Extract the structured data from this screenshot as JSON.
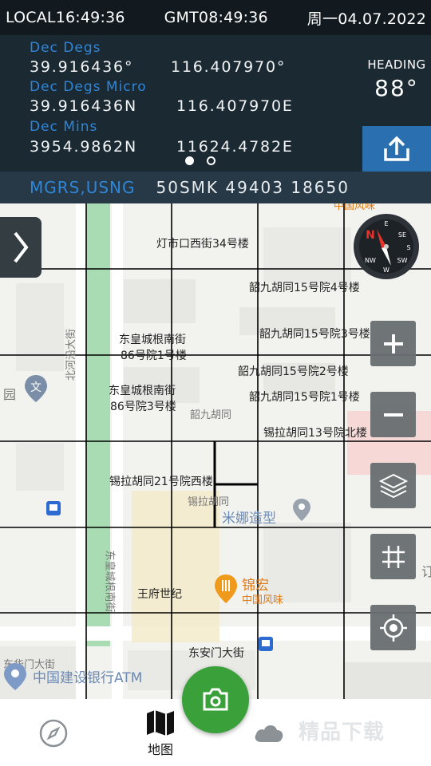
{
  "statusbar": {
    "local_time": "LOCAL16:49:36",
    "gmt_time": "GMT08:49:36",
    "date": "周一04.07.2022"
  },
  "coords": {
    "dec_degs_label": "Dec  Degs",
    "dec_degs_lat": "39.916436°",
    "dec_degs_lon": "116.407970°",
    "dec_micro_label": "Dec  Degs  Micro",
    "dec_micro_lat": "39.916436N",
    "dec_micro_lon": "116.407970E",
    "dec_mins_label": "Dec  Mins",
    "dec_mins_lat": "3954.9862N",
    "dec_mins_lon": "11624.4782E",
    "page_index": 1,
    "page_count": 2
  },
  "heading": {
    "label": "HEADING",
    "value": "88°"
  },
  "mgrs": {
    "label": "MGRS,USNG",
    "value": "50SMK  49403  18650"
  },
  "map": {
    "labels": {
      "a": "灯市口西街34号楼",
      "b": "韶九胡同15号院4号楼",
      "c": "韶九胡同15号院3号楼",
      "d1": "东皇城根南街",
      "d2": "86号院1号楼",
      "e": "韶九胡同15号院2号楼",
      "f1": "东皇城根南街",
      "f2": "86号院3号楼",
      "g": "韶九胡同15号院1号楼",
      "h": "韶九胡同",
      "i": "锡拉胡同13号院北楼",
      "j": "锡拉胡同21号院西楼",
      "k": "锡拉胡同",
      "l": "米娜造型",
      "m": "北河沿大街",
      "n": "东皇城根南街",
      "o": "王府世纪",
      "p": "锦宏",
      "q": "中国风味",
      "r": "东安门大街",
      "s": "东华门大街",
      "t": "中国建设银行ATM",
      "u": "中国风味",
      "v": "园",
      "w": "订"
    }
  },
  "icons": {
    "plus": "zoom-in-icon",
    "minus": "zoom-out-icon",
    "layers": "layers-icon",
    "grid": "grid-icon",
    "locate": "locate-icon",
    "share": "share-icon",
    "compass": "compass-icon",
    "camera": "camera-icon"
  },
  "nav": {
    "map_label": "地图"
  },
  "watermark": "精品下载",
  "colors": {
    "accent_blue": "#2f86d8",
    "panel_dark": "#1a2932",
    "camera_green": "#3aa13a"
  }
}
